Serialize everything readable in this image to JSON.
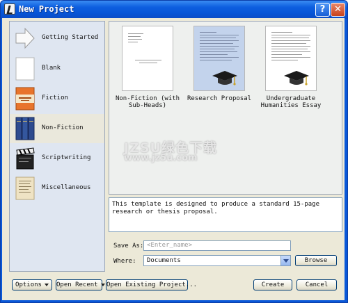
{
  "window": {
    "title": "New Project",
    "help_label": "?",
    "close_label": "✕"
  },
  "sidebar": {
    "items": [
      {
        "label": "Getting Started",
        "icon": "arrow-icon",
        "selected": false
      },
      {
        "label": "Blank",
        "icon": "blank-page-icon",
        "selected": false
      },
      {
        "label": "Fiction",
        "icon": "fiction-book-icon",
        "selected": false
      },
      {
        "label": "Non-Fiction",
        "icon": "non-fiction-books-icon",
        "selected": true
      },
      {
        "label": "Scriptwriting",
        "icon": "clapperboard-icon",
        "selected": false
      },
      {
        "label": "Miscellaneous",
        "icon": "notes-page-icon",
        "selected": false
      }
    ]
  },
  "templates": [
    {
      "label": "Non-Fiction (with Sub-Heads)",
      "selected": false
    },
    {
      "label": "Research Proposal",
      "selected": true
    },
    {
      "label": "Undergraduate Humanities Essay",
      "selected": false
    }
  ],
  "watermark": {
    "line1": "JZSU绿色下载",
    "line2": "www.jz5u.com"
  },
  "description": "This template is designed to produce a standard 15-page research or thesis proposal.",
  "form": {
    "save_as_label": "Save As:",
    "save_as_placeholder": "<Enter_name>",
    "where_label": "Where:",
    "where_value": "Documents",
    "browse_label": "Browse"
  },
  "footer": {
    "options_label": "Options",
    "open_recent_label": "Open Recent",
    "open_existing_label": "Open Existing Project...",
    "create_label": "Create",
    "cancel_label": "Cancel"
  },
  "colors": {
    "titlebar": "#0654d6",
    "dialog_bg": "#ece9d8",
    "sidebar_bg": "#dfe6f1",
    "selected_template_bg": "#c3d3ec"
  }
}
